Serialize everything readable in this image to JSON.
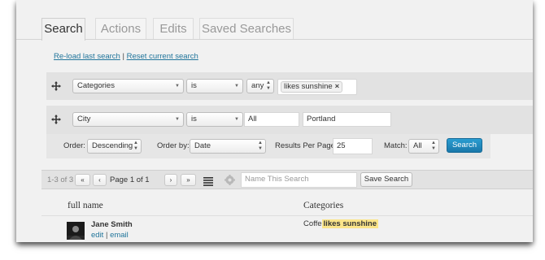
{
  "tabs": [
    {
      "label": "Search",
      "active": true
    },
    {
      "label": "Actions",
      "active": false
    },
    {
      "label": "Edits",
      "active": false
    },
    {
      "label": "Saved Searches",
      "active": false
    }
  ],
  "links": {
    "reload": "Re-load last search",
    "separator": "|",
    "reset": "Reset current search"
  },
  "filters": [
    {
      "field": "Categories",
      "operator": "is",
      "match": "any",
      "tag": "likes sunshine",
      "tag_remove": "×"
    },
    {
      "field": "City",
      "operator": "is",
      "scope": "All",
      "value": "Portland"
    }
  ],
  "options": {
    "order_label": "Order:",
    "order_value": "Descending",
    "order_by_label": "Order by:",
    "order_by_value": "Date",
    "per_page_label": "Results Per Page:",
    "per_page_value": "25",
    "match_label": "Match:",
    "match_value": "All",
    "search_button": "Search"
  },
  "pagination": {
    "count": "1-3 of 3",
    "first": "«",
    "prev": "‹",
    "page_text": "Page 1 of 1",
    "next": "›",
    "last": "»",
    "save_placeholder": "Name This Search",
    "save_button": "Save Search"
  },
  "table": {
    "columns": [
      "full name",
      "Categories"
    ],
    "rows": [
      {
        "name": "Jane Smith",
        "edit": "edit",
        "sep": "|",
        "email": "email",
        "category_prefix": "Coffe",
        "category_highlight": "likes sunshine"
      }
    ]
  },
  "colors": {
    "accent": "#21759b",
    "button_blue": "#1e88c0",
    "highlight": "#fbe58a",
    "panel": "#e2e2e2"
  },
  "icons": [
    "move-handle-icon",
    "chevron-down-icon",
    "list-icon",
    "gear-icon"
  ]
}
